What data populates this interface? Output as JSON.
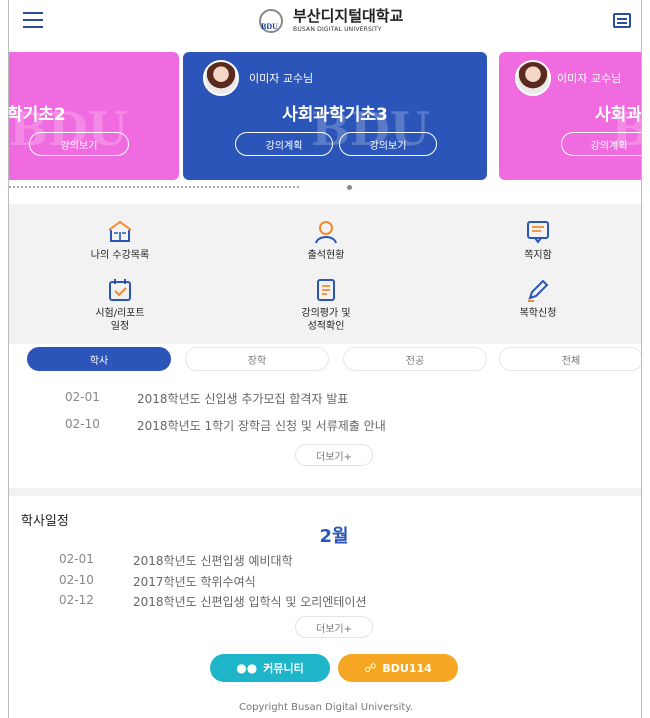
{
  "header": {
    "logo_mark": "BDU",
    "logo_ko": "부산디지털대학교",
    "logo_en": "BUSAN DIGITAL UNIVERSITY"
  },
  "carousel": {
    "cards": [
      {
        "professor": "",
        "title": "학기초2",
        "plan_label": "",
        "view_label": "강의보기",
        "color": "#f06bdf"
      },
      {
        "professor": "이미자 교수님",
        "title": "사회과학기초3",
        "plan_label": "강의계획",
        "view_label": "강의보기",
        "color": "#2b55b8"
      },
      {
        "professor": "이미자 교수님",
        "title": "사회과학",
        "plan_label": "강의계획",
        "view_label": "",
        "color": "#f06bdf"
      }
    ],
    "watermark": "BDU"
  },
  "menu": {
    "items": [
      {
        "label": "나의 수강목록",
        "icon": "book-icon"
      },
      {
        "label": "출석현황",
        "icon": "person-icon"
      },
      {
        "label": "쪽지함",
        "icon": "message-icon"
      },
      {
        "label": "시험/리포트\n일정",
        "icon": "calendar-check-icon"
      },
      {
        "label": "강의평가 및\n성적확인",
        "icon": "document-icon"
      },
      {
        "label": "복학신청",
        "icon": "pencil-icon"
      }
    ]
  },
  "tabs": [
    {
      "label": "학사",
      "active": true
    },
    {
      "label": "장학",
      "active": false
    },
    {
      "label": "전공",
      "active": false
    },
    {
      "label": "전체",
      "active": false
    }
  ],
  "notices": [
    {
      "date": "02-01",
      "title": "2018학년도 신입생 추가모집 합격자 발표"
    },
    {
      "date": "02-10",
      "title": "2018학년도 1학기 장학금 신청 및 서류제출 안내"
    }
  ],
  "notices_more": "더보기+",
  "schedule": {
    "title": "학사일정",
    "month": "2월",
    "items": [
      {
        "date": "02-01",
        "title": "2018학년도 신편입생 예비대학"
      },
      {
        "date": "02-10",
        "title": "2017학년도 학위수여식"
      },
      {
        "date": "02-12",
        "title": "2018학년도 신편입생 입학식 및 오리엔테이션"
      }
    ],
    "more": "더보기+"
  },
  "footer": {
    "community_label": "커뮤니티",
    "help_label": "BDU114",
    "copyright": "Copyright Busan Digital University."
  },
  "colors": {
    "primary": "#2b55b8",
    "card_pink": "#f06bdf",
    "teal": "#1fb5c9",
    "orange": "#f5a623"
  }
}
